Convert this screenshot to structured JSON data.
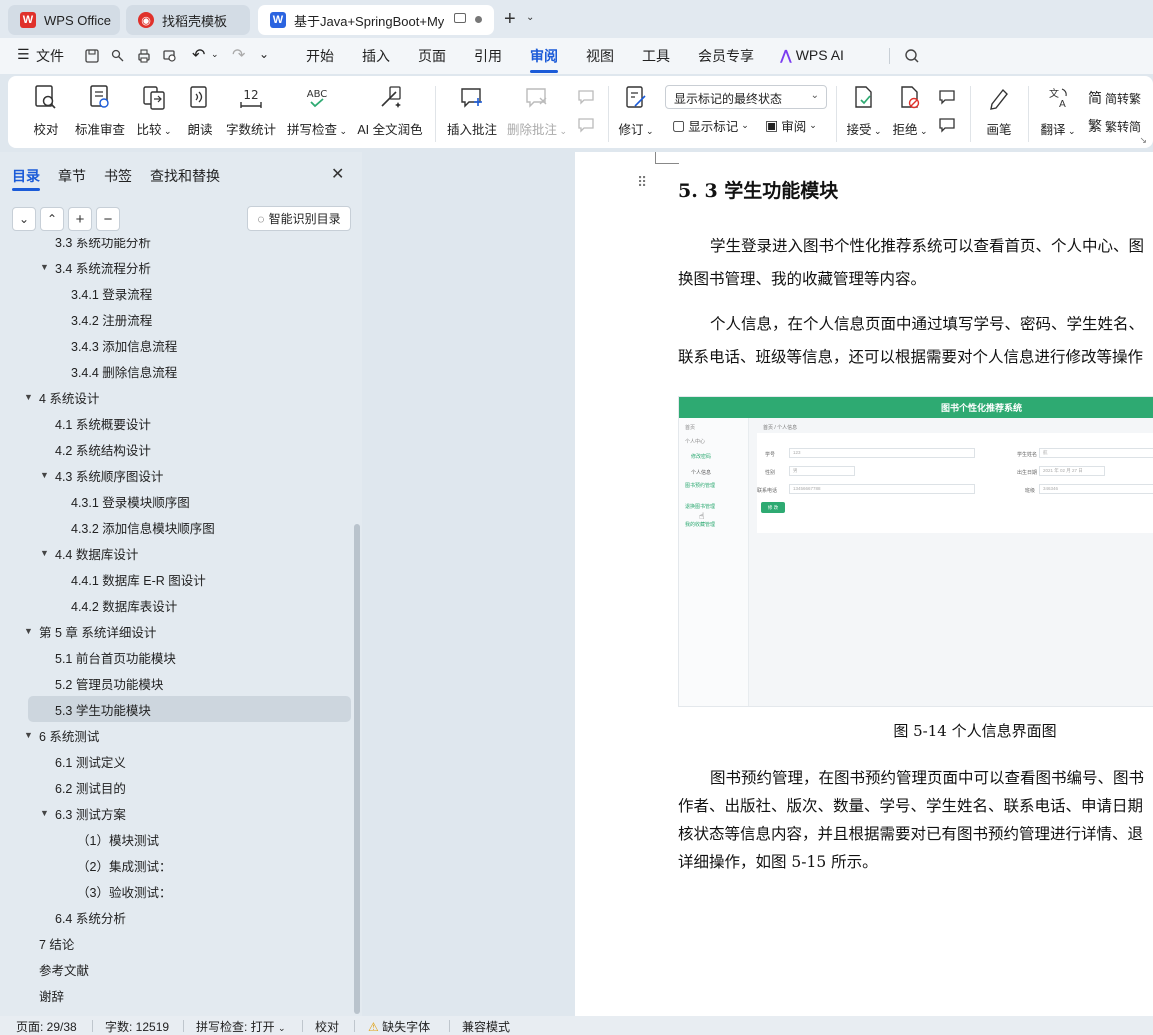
{
  "tabs": [
    {
      "label": "WPS Office",
      "logo": "W",
      "logo_color": "#e0312b"
    },
    {
      "label": "找稻壳模板",
      "logo": "◉",
      "logo_color": "#e0312b"
    },
    {
      "label": "基于Java+SpringBoot+MyS",
      "logo": "W",
      "logo_color": "#2b64e0"
    }
  ],
  "menubar": {
    "file_label": "文件",
    "items": [
      "开始",
      "插入",
      "页面",
      "引用",
      "审阅",
      "视图",
      "工具",
      "会员专享"
    ],
    "active": "审阅",
    "ai_label": "WPS AI"
  },
  "ribbon": {
    "proofread": "校对",
    "standard_review": "标准审查",
    "compare": "比较",
    "read_aloud": "朗读",
    "word_count": "字数统计",
    "spell_check": "拼写检查",
    "ai_polish": "AI 全文润色",
    "insert_comment": "插入批注",
    "delete_comment": "删除批注",
    "revise": "修订",
    "markup_select": "显示标记的最终状态",
    "show_markup": "显示标记",
    "review": "审阅",
    "accept": "接受",
    "reject": "拒绝",
    "pen": "画笔",
    "translate": "翻译",
    "to_traditional": "简转繁",
    "to_simplified": "繁转简",
    "wordcount_icon_text": "12",
    "spell_icon_text": "ABC"
  },
  "nav": {
    "tabs": [
      "目录",
      "章节",
      "书签",
      "查找和替换"
    ],
    "smart_toc": "智能识别目录",
    "items": [
      {
        "text": "3.3 系统功能分析",
        "level": 2,
        "arrow": false,
        "partial": true
      },
      {
        "text": "3.4 系统流程分析",
        "level": 2,
        "arrow": true
      },
      {
        "text": "3.4.1 登录流程",
        "level": 3,
        "arrow": false
      },
      {
        "text": "3.4.2 注册流程",
        "level": 3,
        "arrow": false
      },
      {
        "text": "3.4.3 添加信息流程",
        "level": 3,
        "arrow": false
      },
      {
        "text": "3.4.4 删除信息流程",
        "level": 3,
        "arrow": false
      },
      {
        "text": "4   系统设计",
        "level": 1,
        "arrow": true
      },
      {
        "text": "4.1 系统概要设计",
        "level": 2,
        "arrow": false
      },
      {
        "text": "4.2 系统结构设计",
        "level": 2,
        "arrow": false
      },
      {
        "text": "4.3 系统顺序图设计",
        "level": 2,
        "arrow": true
      },
      {
        "text": "4.3.1 登录模块顺序图",
        "level": 3,
        "arrow": false
      },
      {
        "text": "4.3.2 添加信息模块顺序图",
        "level": 3,
        "arrow": false
      },
      {
        "text": "4.4 数据库设计",
        "level": 2,
        "arrow": true
      },
      {
        "text": "4.4.1 数据库 E-R 图设计",
        "level": 3,
        "arrow": false
      },
      {
        "text": "4.4.2 数据库表设计",
        "level": 3,
        "arrow": false
      },
      {
        "text": "第 5 章  系统详细设计",
        "level": 1,
        "arrow": true
      },
      {
        "text": "5.1 前台首页功能模块",
        "level": 2,
        "arrow": false
      },
      {
        "text": "5.2 管理员功能模块",
        "level": 2,
        "arrow": false
      },
      {
        "text": "5.3 学生功能模块",
        "level": 2,
        "arrow": false,
        "selected": true
      },
      {
        "text": "6  系统测试",
        "level": 1,
        "arrow": true
      },
      {
        "text": "6.1  测试定义",
        "level": 2,
        "arrow": false
      },
      {
        "text": "6.2  测试目的",
        "level": 2,
        "arrow": false
      },
      {
        "text": "6.3 测试方案",
        "level": 2,
        "arrow": true
      },
      {
        "text": "（1）模块测试",
        "level": 3,
        "arrow": false,
        "extra": 6
      },
      {
        "text": "（2）集成测试：",
        "level": 3,
        "arrow": false,
        "extra": 6
      },
      {
        "text": "（3）验收测试：",
        "level": 3,
        "arrow": false,
        "extra": 6
      },
      {
        "text": "6.4 系统分析",
        "level": 2,
        "arrow": false
      },
      {
        "text": "7  结论",
        "level": 1,
        "arrow": false
      },
      {
        "text": "参考文献",
        "level": 1,
        "arrow": false
      },
      {
        "text": "谢辞",
        "level": 1,
        "arrow": false
      }
    ]
  },
  "document": {
    "heading": "5. 3 学生功能模块",
    "para1_line1": "学生登录进入图书个性化推荐系统可以查看首页、个人中心、图",
    "para1_line2": "换图书管理、我的收藏管理等内容。",
    "para2_line1": "个人信息，在个人信息页面中通过填写学号、密码、学生姓名、",
    "para2_line2": "联系电话、班级等信息，还可以根据需要对个人信息进行修改等操作",
    "figure_caption": "图 5-14 个人信息界面图",
    "para3_line1": "图书预约管理，在图书预约管理页面中可以查看图书编号、图书",
    "para3_line2": "作者、出版社、版次、数量、学号、学生姓名、联系电话、申请日期",
    "para3_line3": "核状态等信息内容，并且根据需要对已有图书预约管理进行详情、退",
    "para3_line4": "详细操作，如图 5-15 所示。",
    "figure": {
      "title": "图书个性化推荐系统",
      "crumb": "首页 / 个人信息",
      "side_items": [
        "首页",
        "个人中心",
        "修改密码",
        "个人信息",
        "图书预约管理",
        "退换图书管理",
        "我的收藏管理"
      ],
      "labels": {
        "xuehao": "学号",
        "xingbie": "性别",
        "dianhua": "联系电话",
        "xingming": "学生姓名",
        "shengri": "出生日期",
        "banji": "班级"
      },
      "values": {
        "xuehao": "123",
        "xingbie": "男",
        "dianhua": "13456667788",
        "xingming": "航",
        "shengri": "2021 年 02 月 27 日",
        "banji": "346346"
      },
      "button": "修 改"
    }
  },
  "statusbar": {
    "page": "页面: 29/38",
    "words": "字数: 12519",
    "spell": "拼写检查: 打开",
    "proof": "校对",
    "missing_font": "缺失字体",
    "compat": "兼容模式"
  }
}
